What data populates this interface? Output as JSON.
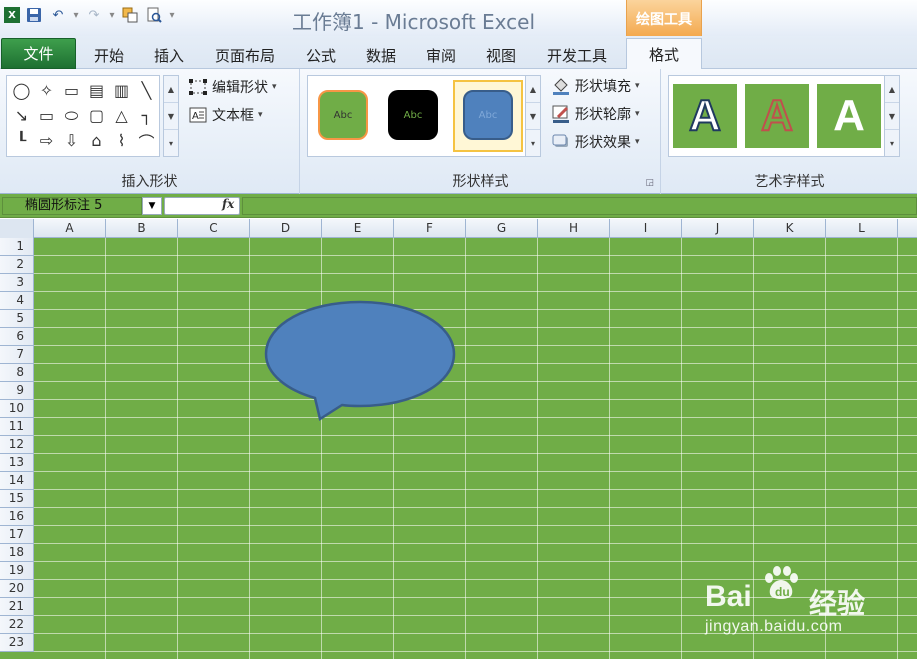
{
  "window": {
    "title": "工作簿1 - Microsoft Excel",
    "context_tab_group": "绘图工具"
  },
  "tabs": [
    {
      "label": "文件"
    },
    {
      "label": "开始"
    },
    {
      "label": "插入"
    },
    {
      "label": "页面布局"
    },
    {
      "label": "公式"
    },
    {
      "label": "数据"
    },
    {
      "label": "审阅"
    },
    {
      "label": "视图"
    },
    {
      "label": "开发工具"
    },
    {
      "label": "格式"
    }
  ],
  "ribbon": {
    "insert_shapes": {
      "label": "插入形状",
      "edit_shape": "编辑形状",
      "text_box": "文本框"
    },
    "shape_styles": {
      "label": "形状样式",
      "swatch_text": "Abc",
      "fill": "形状填充",
      "outline": "形状轮廓",
      "effects": "形状效果"
    },
    "wordart_styles": {
      "label": "艺术字样式",
      "sample": "A"
    }
  },
  "formula_bar": {
    "name_box": "椭圆形标注 5",
    "fx": "fx",
    "value": ""
  },
  "columns": [
    "A",
    "B",
    "C",
    "D",
    "E",
    "F",
    "G",
    "H",
    "I",
    "J",
    "K",
    "L"
  ],
  "rows": [
    "1",
    "2",
    "3",
    "4",
    "5",
    "6",
    "7",
    "8",
    "9",
    "10",
    "11",
    "12",
    "13",
    "14",
    "15",
    "16",
    "17",
    "18",
    "19",
    "20",
    "21",
    "22",
    "23"
  ],
  "colors": {
    "sheet_fill": "#70ad47",
    "shape_fill": "#4f81bd",
    "shape_outline": "#385d8a",
    "file_tab": "#2a8a3f",
    "context_tab": "#f3a74b"
  },
  "watermark": {
    "brand": "Bai",
    "brand_cn": "经验",
    "url": "jingyan.baidu.com"
  }
}
